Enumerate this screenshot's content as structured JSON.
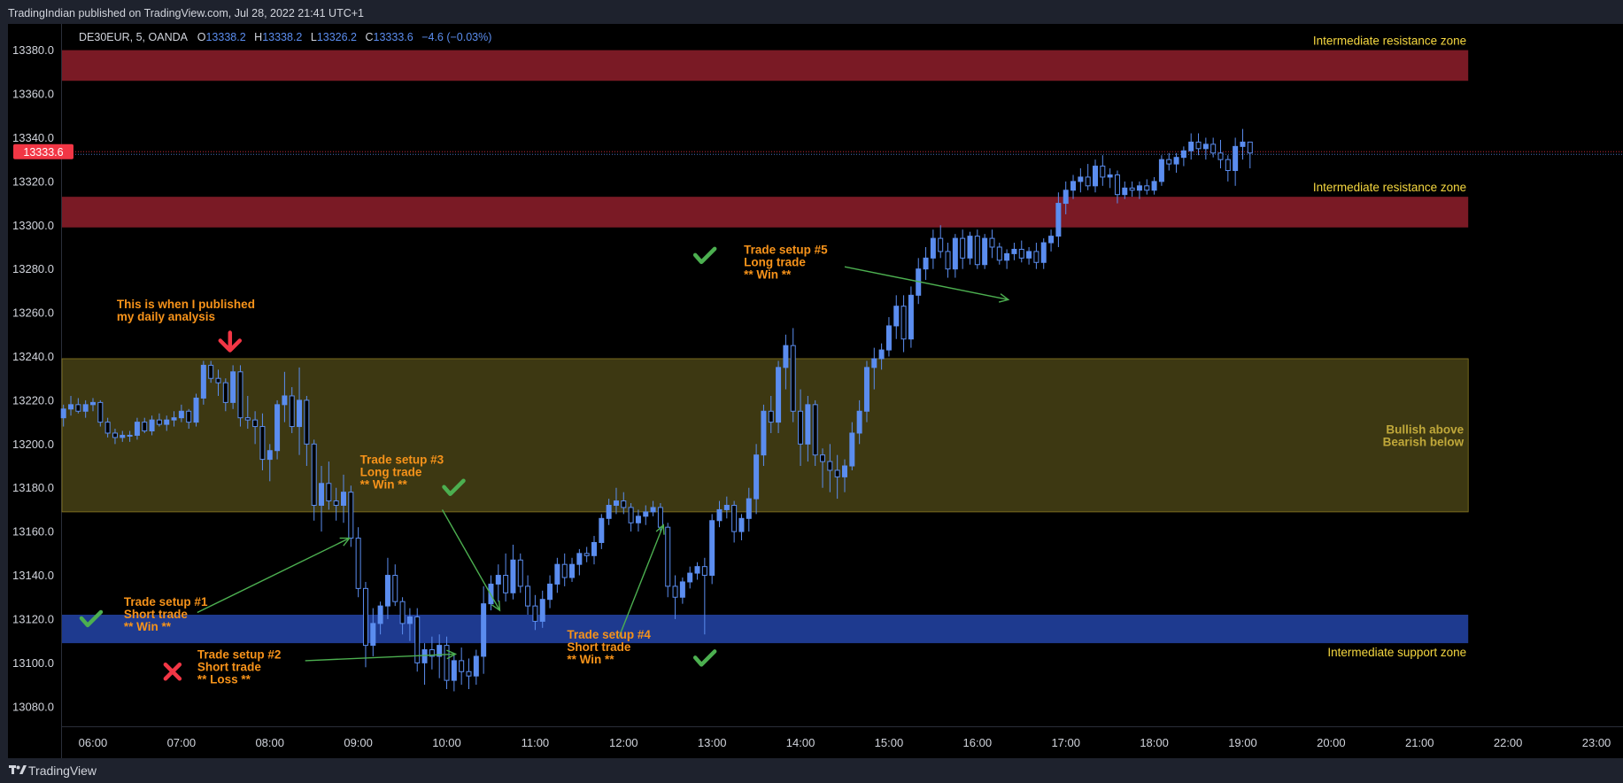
{
  "header": {
    "published_text": "TradingIndian published on TradingView.com, Jul 28, 2022 21:41 UTC+1"
  },
  "footer": {
    "brand": "TradingView"
  },
  "colors": {
    "background": "#000000",
    "frame": "#1e222d",
    "candle_up": "#5b8def",
    "candle_down": "#000000",
    "resistance_zone": "#7a1a25",
    "neutral_zone": "#3d3812",
    "support_zone": "#1e3a8f",
    "annotation": "#f7931a",
    "zone_label": "#f5d740",
    "neutral_label": "#c0a83a",
    "arrow": "#4caf50",
    "check": "#4caf50",
    "cross": "#f23645",
    "price_badge": "#f23645"
  },
  "legend": {
    "symbol": "DE30EUR, 5, OANDA",
    "o_label": "O",
    "o_value": "13338.2",
    "h_label": "H",
    "h_value": "13338.2",
    "l_label": "L",
    "l_value": "13326.2",
    "c_label": "C",
    "c_value": "13333.6",
    "change": "−4.6 (−0.03%)"
  },
  "chart_data": {
    "type": "candlestick",
    "symbol": "DE30EUR",
    "interval": "5",
    "source": "OANDA",
    "ylim": [
      13071,
      13392
    ],
    "xlim": [
      5.65,
      23.3
    ],
    "y_ticks": [
      "13380.0",
      "13360.0",
      "13340.0",
      "13320.0",
      "13300.0",
      "13280.0",
      "13260.0",
      "13240.0",
      "13220.0",
      "13200.0",
      "13180.0",
      "13160.0",
      "13140.0",
      "13120.0",
      "13100.0",
      "13080.0"
    ],
    "x_ticks": [
      {
        "label": "06:00",
        "t": 6
      },
      {
        "label": "07:00",
        "t": 7
      },
      {
        "label": "08:00",
        "t": 8
      },
      {
        "label": "09:00",
        "t": 9
      },
      {
        "label": "10:00",
        "t": 10
      },
      {
        "label": "11:00",
        "t": 11
      },
      {
        "label": "12:00",
        "t": 12
      },
      {
        "label": "13:00",
        "t": 13
      },
      {
        "label": "14:00",
        "t": 14
      },
      {
        "label": "15:00",
        "t": 15
      },
      {
        "label": "16:00",
        "t": 16
      },
      {
        "label": "17:00",
        "t": 17
      },
      {
        "label": "18:00",
        "t": 18
      },
      {
        "label": "19:00",
        "t": 19
      },
      {
        "label": "20:00",
        "t": 20
      },
      {
        "label": "21:00",
        "t": 21
      },
      {
        "label": "22:00",
        "t": 22
      },
      {
        "label": "23:00",
        "t": 23
      }
    ],
    "last_price": "13333.6",
    "last_price_value": 13333.6,
    "zones": [
      {
        "name": "resistance-zone-upper",
        "kind": "resistance",
        "y_from": 13366,
        "y_to": 13380,
        "label": "Intermediate resistance zone"
      },
      {
        "name": "resistance-zone-lower",
        "kind": "resistance",
        "y_from": 13299,
        "y_to": 13313,
        "label": "Intermediate resistance zone"
      },
      {
        "name": "neutral-zone",
        "kind": "neutral",
        "y_from": 13169,
        "y_to": 13239,
        "label_lines": [
          "Bullish above",
          "Bearish below"
        ]
      },
      {
        "name": "support-zone",
        "kind": "support",
        "y_from": 13109,
        "y_to": 13122,
        "label": "Intermediate support zone"
      }
    ],
    "zones_t_end": 21.55,
    "annotations": [
      {
        "name": "publish-note",
        "t": 6.27,
        "y": 13262,
        "lines": [
          "This is when I published",
          "my daily analysis"
        ]
      },
      {
        "name": "trade-setup-1",
        "t": 6.35,
        "y": 13126,
        "lines": [
          "Trade setup #1",
          "Short trade",
          "** Win **"
        ]
      },
      {
        "name": "trade-setup-2",
        "t": 7.18,
        "y": 13102,
        "lines": [
          "Trade setup #2",
          "Short trade",
          "** Loss **"
        ]
      },
      {
        "name": "trade-setup-3",
        "t": 9.02,
        "y": 13191,
        "lines": [
          "Trade setup #3",
          "Long trade",
          "** Win **"
        ]
      },
      {
        "name": "trade-setup-4",
        "t": 11.36,
        "y": 13111,
        "lines": [
          "Trade setup #4",
          "Short trade",
          "** Win **"
        ]
      },
      {
        "name": "trade-setup-5",
        "t": 13.36,
        "y": 13287,
        "lines": [
          "Trade setup #5",
          "Long trade",
          "** Win **"
        ]
      }
    ],
    "arrows": [
      {
        "name": "arrow-setup-1",
        "t1": 7.18,
        "y1": 13123,
        "t2": 8.9,
        "y2": 13157
      },
      {
        "name": "arrow-setup-2",
        "t1": 8.4,
        "y1": 13101,
        "t2": 10.1,
        "y2": 13104
      },
      {
        "name": "arrow-setup-3",
        "t1": 9.95,
        "y1": 13170,
        "t2": 10.6,
        "y2": 13124
      },
      {
        "name": "arrow-setup-4",
        "t1": 11.95,
        "y1": 13112,
        "t2": 12.45,
        "y2": 13163
      },
      {
        "name": "arrow-setup-5",
        "t1": 14.5,
        "y1": 13281,
        "t2": 16.35,
        "y2": 13266
      }
    ],
    "marks": [
      {
        "name": "win-check-1",
        "kind": "check",
        "t": 5.98,
        "y": 13120
      },
      {
        "name": "loss-cross-2",
        "kind": "cross",
        "t": 6.9,
        "y": 13096
      },
      {
        "name": "win-check-3",
        "kind": "check",
        "t": 10.08,
        "y": 13180
      },
      {
        "name": "win-check-4",
        "kind": "check",
        "t": 12.92,
        "y": 13102
      },
      {
        "name": "win-check-5",
        "kind": "check",
        "t": 12.92,
        "y": 13286
      },
      {
        "name": "publish-arrow-down",
        "kind": "down",
        "t": 7.55,
        "y": 13242
      }
    ],
    "candles_t0": 5.667,
    "candles_dt": 0.08333,
    "candles_ohlc": [
      [
        13212,
        13218,
        13208,
        13216
      ],
      [
        13216,
        13222,
        13213,
        13218
      ],
      [
        13218,
        13221,
        13214,
        13215
      ],
      [
        13215,
        13220,
        13212,
        13218
      ],
      [
        13218,
        13221,
        13215,
        13219
      ],
      [
        13219,
        13220,
        13208,
        13210
      ],
      [
        13210,
        13212,
        13203,
        13205
      ],
      [
        13205,
        13207,
        13200,
        13203
      ],
      [
        13203,
        13206,
        13201,
        13204
      ],
      [
        13204,
        13206,
        13201,
        13204
      ],
      [
        13204,
        13212,
        13202,
        13210
      ],
      [
        13210,
        13212,
        13205,
        13206
      ],
      [
        13206,
        13213,
        13204,
        13211
      ],
      [
        13211,
        13214,
        13208,
        13209
      ],
      [
        13209,
        13213,
        13206,
        13211
      ],
      [
        13211,
        13215,
        13208,
        13212
      ],
      [
        13212,
        13218,
        13210,
        13215
      ],
      [
        13215,
        13216,
        13207,
        13210
      ],
      [
        13210,
        13223,
        13208,
        13221
      ],
      [
        13221,
        13238,
        13218,
        13236
      ],
      [
        13236,
        13238,
        13228,
        13230
      ],
      [
        13230,
        13234,
        13222,
        13228
      ],
      [
        13228,
        13230,
        13215,
        13219
      ],
      [
        13219,
        13236,
        13216,
        13233
      ],
      [
        13233,
        13236,
        13208,
        13212
      ],
      [
        13212,
        13222,
        13207,
        13211
      ],
      [
        13211,
        13215,
        13200,
        13208
      ],
      [
        13208,
        13214,
        13188,
        13193
      ],
      [
        13193,
        13200,
        13183,
        13197
      ],
      [
        13197,
        13220,
        13193,
        13218
      ],
      [
        13218,
        13233,
        13210,
        13222
      ],
      [
        13222,
        13226,
        13205,
        13208
      ],
      [
        13208,
        13235,
        13195,
        13220
      ],
      [
        13220,
        13222,
        13190,
        13200
      ],
      [
        13200,
        13202,
        13165,
        13172
      ],
      [
        13172,
        13190,
        13160,
        13182
      ],
      [
        13182,
        13192,
        13170,
        13174
      ],
      [
        13174,
        13180,
        13165,
        13172
      ],
      [
        13172,
        13186,
        13164,
        13178
      ],
      [
        13178,
        13181,
        13153,
        13157
      ],
      [
        13157,
        13162,
        13130,
        13134
      ],
      [
        13134,
        13137,
        13098,
        13108
      ],
      [
        13108,
        13125,
        13103,
        13118
      ],
      [
        13118,
        13128,
        13113,
        13126
      ],
      [
        13126,
        13148,
        13120,
        13140
      ],
      [
        13140,
        13145,
        13126,
        13128
      ],
      [
        13128,
        13130,
        13113,
        13118
      ],
      [
        13118,
        13125,
        13110,
        13121
      ],
      [
        13121,
        13125,
        13096,
        13100
      ],
      [
        13100,
        13109,
        13090,
        13106
      ],
      [
        13106,
        13112,
        13097,
        13103
      ],
      [
        13103,
        13113,
        13093,
        13108
      ],
      [
        13108,
        13112,
        13088,
        13092
      ],
      [
        13092,
        13104,
        13087,
        13101
      ],
      [
        13101,
        13107,
        13090,
        13096
      ],
      [
        13096,
        13102,
        13088,
        13094
      ],
      [
        13094,
        13106,
        13090,
        13103
      ],
      [
        13103,
        13135,
        13095,
        13127
      ],
      [
        13127,
        13140,
        13124,
        13136
      ],
      [
        13136,
        13145,
        13128,
        13140
      ],
      [
        13140,
        13150,
        13128,
        13132
      ],
      [
        13132,
        13154,
        13129,
        13147
      ],
      [
        13147,
        13150,
        13132,
        13135
      ],
      [
        13135,
        13140,
        13122,
        13126
      ],
      [
        13126,
        13131,
        13115,
        13119
      ],
      [
        13119,
        13133,
        13116,
        13129
      ],
      [
        13129,
        13140,
        13125,
        13136
      ],
      [
        13136,
        13148,
        13132,
        13145
      ],
      [
        13145,
        13150,
        13135,
        13139
      ],
      [
        13139,
        13148,
        13137,
        13145
      ],
      [
        13145,
        13152,
        13140,
        13150
      ],
      [
        13150,
        13153,
        13146,
        13149
      ],
      [
        13149,
        13158,
        13145,
        13155
      ],
      [
        13155,
        13168,
        13152,
        13166
      ],
      [
        13166,
        13175,
        13163,
        13172
      ],
      [
        13172,
        13180,
        13168,
        13174
      ],
      [
        13174,
        13178,
        13168,
        13171
      ],
      [
        13171,
        13173,
        13160,
        13164
      ],
      [
        13164,
        13170,
        13160,
        13167
      ],
      [
        13167,
        13172,
        13163,
        13169
      ],
      [
        13169,
        13174,
        13167,
        13171
      ],
      [
        13171,
        13173,
        13160,
        13162
      ],
      [
        13162,
        13164,
        13130,
        13135
      ],
      [
        13135,
        13140,
        13120,
        13130
      ],
      [
        13130,
        13139,
        13127,
        13137
      ],
      [
        13137,
        13144,
        13134,
        13141
      ],
      [
        13141,
        13146,
        13138,
        13144
      ],
      [
        13144,
        13148,
        13113,
        13140
      ],
      [
        13140,
        13168,
        13136,
        13165
      ],
      [
        13165,
        13174,
        13162,
        13170
      ],
      [
        13170,
        13176,
        13166,
        13172
      ],
      [
        13172,
        13174,
        13155,
        13160
      ],
      [
        13160,
        13168,
        13156,
        13166
      ],
      [
        13166,
        13180,
        13160,
        13175
      ],
      [
        13175,
        13200,
        13168,
        13195
      ],
      [
        13195,
        13218,
        13190,
        13215
      ],
      [
        13215,
        13222,
        13205,
        13210
      ],
      [
        13210,
        13238,
        13205,
        13235
      ],
      [
        13235,
        13250,
        13225,
        13245
      ],
      [
        13245,
        13253,
        13210,
        13215
      ],
      [
        13215,
        13225,
        13190,
        13200
      ],
      [
        13200,
        13222,
        13192,
        13218
      ],
      [
        13218,
        13220,
        13190,
        13195
      ],
      [
        13195,
        13198,
        13180,
        13192
      ],
      [
        13192,
        13200,
        13178,
        13188
      ],
      [
        13188,
        13195,
        13175,
        13185
      ],
      [
        13185,
        13193,
        13178,
        13190
      ],
      [
        13190,
        13210,
        13188,
        13205
      ],
      [
        13205,
        13220,
        13200,
        13215
      ],
      [
        13215,
        13238,
        13210,
        13235
      ],
      [
        13235,
        13244,
        13225,
        13239
      ],
      [
        13239,
        13246,
        13234,
        13243
      ],
      [
        13243,
        13258,
        13240,
        13254
      ],
      [
        13254,
        13268,
        13248,
        13263
      ],
      [
        13263,
        13268,
        13242,
        13248
      ],
      [
        13248,
        13272,
        13244,
        13268
      ],
      [
        13268,
        13285,
        13264,
        13280
      ],
      [
        13280,
        13290,
        13275,
        13285
      ],
      [
        13285,
        13298,
        13280,
        13294
      ],
      [
        13294,
        13300,
        13285,
        13288
      ],
      [
        13288,
        13292,
        13276,
        13280
      ],
      [
        13280,
        13296,
        13276,
        13294
      ],
      [
        13294,
        13298,
        13280,
        13285
      ],
      [
        13285,
        13297,
        13282,
        13295
      ],
      [
        13295,
        13298,
        13280,
        13282
      ],
      [
        13282,
        13296,
        13280,
        13294
      ],
      [
        13294,
        13298,
        13285,
        13290
      ],
      [
        13290,
        13292,
        13282,
        13284
      ],
      [
        13284,
        13289,
        13280,
        13287
      ],
      [
        13287,
        13292,
        13284,
        13289
      ],
      [
        13289,
        13293,
        13283,
        13285
      ],
      [
        13285,
        13290,
        13282,
        13288
      ],
      [
        13288,
        13292,
        13280,
        13283
      ],
      [
        13283,
        13294,
        13280,
        13292
      ],
      [
        13292,
        13298,
        13288,
        13295
      ],
      [
        13295,
        13315,
        13290,
        13310
      ],
      [
        13310,
        13320,
        13305,
        13316
      ],
      [
        13316,
        13323,
        13312,
        13320
      ],
      [
        13320,
        13326,
        13315,
        13322
      ],
      [
        13322,
        13328,
        13316,
        13318
      ],
      [
        13318,
        13330,
        13315,
        13327
      ],
      [
        13327,
        13332,
        13318,
        13322
      ],
      [
        13322,
        13326,
        13317,
        13323
      ],
      [
        13323,
        13325,
        13310,
        13314
      ],
      [
        13314,
        13320,
        13312,
        13317
      ],
      [
        13317,
        13320,
        13313,
        13316
      ],
      [
        13316,
        13320,
        13312,
        13318
      ],
      [
        13318,
        13321,
        13314,
        13316
      ],
      [
        13316,
        13322,
        13314,
        13320
      ],
      [
        13320,
        13332,
        13318,
        13330
      ],
      [
        13330,
        13333,
        13325,
        13328
      ],
      [
        13328,
        13333,
        13324,
        13331
      ],
      [
        13331,
        13336,
        13327,
        13334
      ],
      [
        13334,
        13342,
        13330,
        13338
      ],
      [
        13338,
        13342,
        13332,
        13335
      ],
      [
        13335,
        13340,
        13330,
        13337
      ],
      [
        13337,
        13340,
        13331,
        13333
      ],
      [
        13333,
        13339,
        13326,
        13330
      ],
      [
        13330,
        13332,
        13320,
        13325
      ],
      [
        13325,
        13340,
        13318,
        13336
      ],
      [
        13336,
        13344,
        13330,
        13338
      ],
      [
        13338,
        13338,
        13326,
        13333
      ]
    ]
  }
}
